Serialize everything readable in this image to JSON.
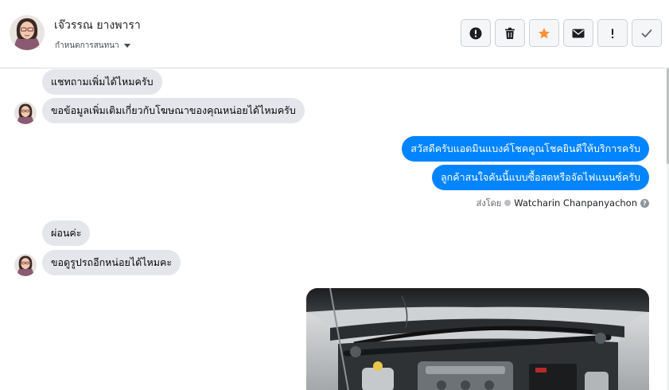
{
  "header": {
    "contact_name": "เจ๊วรรณ ยางพารา",
    "assign_label": "กำหนดการสนทนา",
    "actions": [
      {
        "name": "report-button",
        "icon": "exclamation-circle-icon"
      },
      {
        "name": "delete-button",
        "icon": "trash-icon"
      },
      {
        "name": "star-button",
        "icon": "star-icon"
      },
      {
        "name": "mark-unread-button",
        "icon": "envelope-icon"
      },
      {
        "name": "important-button",
        "icon": "exclamation-icon"
      },
      {
        "name": "done-button",
        "icon": "check-icon"
      }
    ]
  },
  "messages": [
    {
      "from": "contact",
      "text": "แชทถามเพิ่มได้ไหมครับ"
    },
    {
      "from": "contact",
      "text": "ขอข้อมูลเพิ่มเติมเกี่ยวกับโฆษณาของคุณหน่อยได้ไหมครับ"
    },
    {
      "from": "page",
      "text": "สวัสดีครับแอดมินแบงค์โชคคูณโชคยินดีให้บริการครับ"
    },
    {
      "from": "page",
      "text": "ลูกค้าสนใจคันนี้แบบซื้อสดหรือจัดไฟแนนซ์ครับ"
    },
    {
      "from": "contact",
      "text": "ผ่อนค่ะ"
    },
    {
      "from": "contact",
      "text": "ขอดูรูปรถอีกหน่อยได้ไหมคะ"
    }
  ],
  "sent_by": {
    "prefix": "ส่งโดย",
    "agent": "Watcharin Chanpanyachon"
  },
  "colors": {
    "outgoing_bubble": "#0084ff",
    "incoming_bubble": "#e4e6eb",
    "star": "#f7923b"
  }
}
